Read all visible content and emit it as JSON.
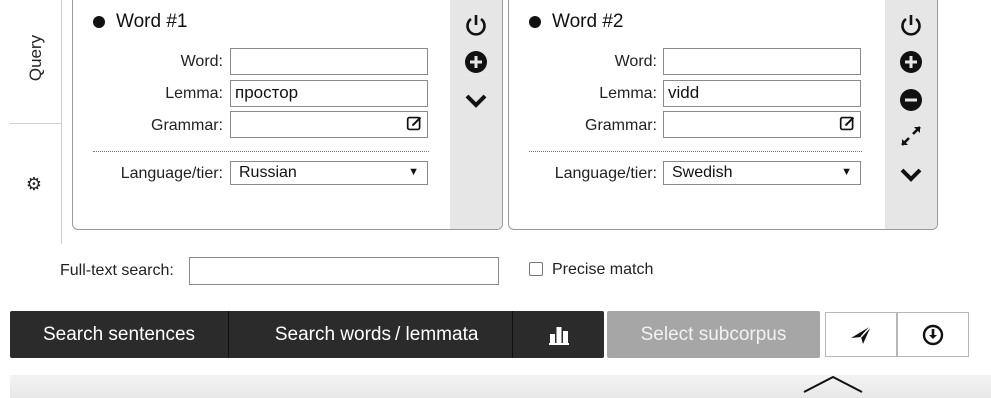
{
  "tabs": {
    "query": "Query",
    "settings_icon": "gear-icon"
  },
  "words": [
    {
      "title": "Word #1",
      "labels": {
        "word": "Word:",
        "lemma": "Lemma:",
        "grammar": "Grammar:",
        "language": "Language/tier:"
      },
      "word_value": "",
      "lemma_value": "простор",
      "grammar_value": "",
      "language_value": "Russian",
      "side_icons": [
        "power-icon",
        "plus-circle-icon",
        "chevron-down-icon"
      ]
    },
    {
      "title": "Word #2",
      "labels": {
        "word": "Word:",
        "lemma": "Lemma:",
        "grammar": "Grammar:",
        "language": "Language/tier:"
      },
      "word_value": "",
      "lemma_value": "vidd",
      "grammar_value": "",
      "language_value": "Swedish",
      "side_icons": [
        "power-icon",
        "plus-circle-icon",
        "minus-circle-icon",
        "expand-icon",
        "chevron-down-icon"
      ]
    }
  ],
  "fulltext": {
    "label": "Full-text search:",
    "value": ""
  },
  "precise": {
    "label": "Precise match",
    "checked": false
  },
  "actions": {
    "search_sentences": "Search sentences",
    "search_words": "Search words",
    "lemmata": "/ lemmata",
    "stats_icon": "bar-chart-icon",
    "select_subcorpus": "Select subcorpus",
    "share_icon": "paper-plane-icon",
    "download_icon": "download-icon"
  },
  "footer": {
    "collapse_icon": "chevron-up-icon"
  },
  "colors": {
    "dark_bar": "#2b2b2b",
    "disabled_button": "#a6a6a6",
    "side_panel": "#e6e6e6"
  }
}
